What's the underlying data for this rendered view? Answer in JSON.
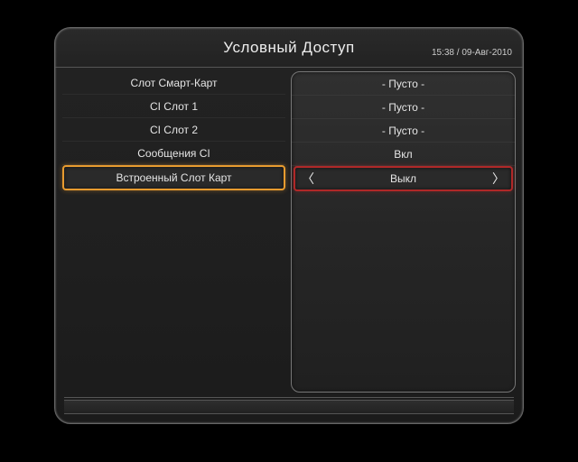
{
  "header": {
    "title": "Условный Доступ",
    "datetime": "15:38 / 09-Авг-2010"
  },
  "menu": {
    "items": [
      {
        "label": "Слот Смарт-Карт",
        "value": "- Пусто -"
      },
      {
        "label": "CI Слот 1",
        "value": "- Пусто -"
      },
      {
        "label": "CI Слот 2",
        "value": "- Пусто -"
      },
      {
        "label": "Сообщения CI",
        "value": "Вкл"
      },
      {
        "label": "Встроенный Слот Карт",
        "value": "Выкл",
        "selected": true
      }
    ]
  }
}
